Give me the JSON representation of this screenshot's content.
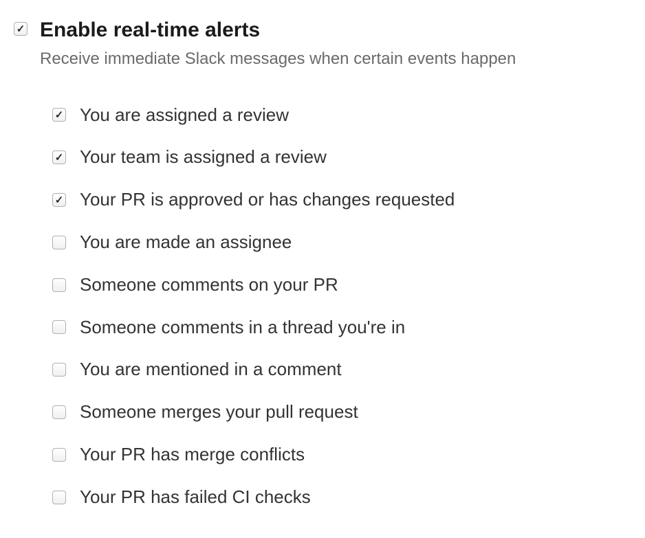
{
  "header": {
    "checked": true,
    "title": "Enable real-time alerts",
    "subtitle": "Receive immediate Slack messages when certain events happen"
  },
  "options": [
    {
      "label": "You are assigned a review",
      "checked": true
    },
    {
      "label": "Your team is assigned a review",
      "checked": true
    },
    {
      "label": "Your PR is approved or has changes requested",
      "checked": true
    },
    {
      "label": "You are made an assignee",
      "checked": false
    },
    {
      "label": "Someone comments on your PR",
      "checked": false
    },
    {
      "label": "Someone comments in a thread you're in",
      "checked": false
    },
    {
      "label": "You are mentioned in a comment",
      "checked": false
    },
    {
      "label": "Someone merges your pull request",
      "checked": false
    },
    {
      "label": "Your PR has merge conflicts",
      "checked": false
    },
    {
      "label": "Your PR has failed CI checks",
      "checked": false
    }
  ]
}
